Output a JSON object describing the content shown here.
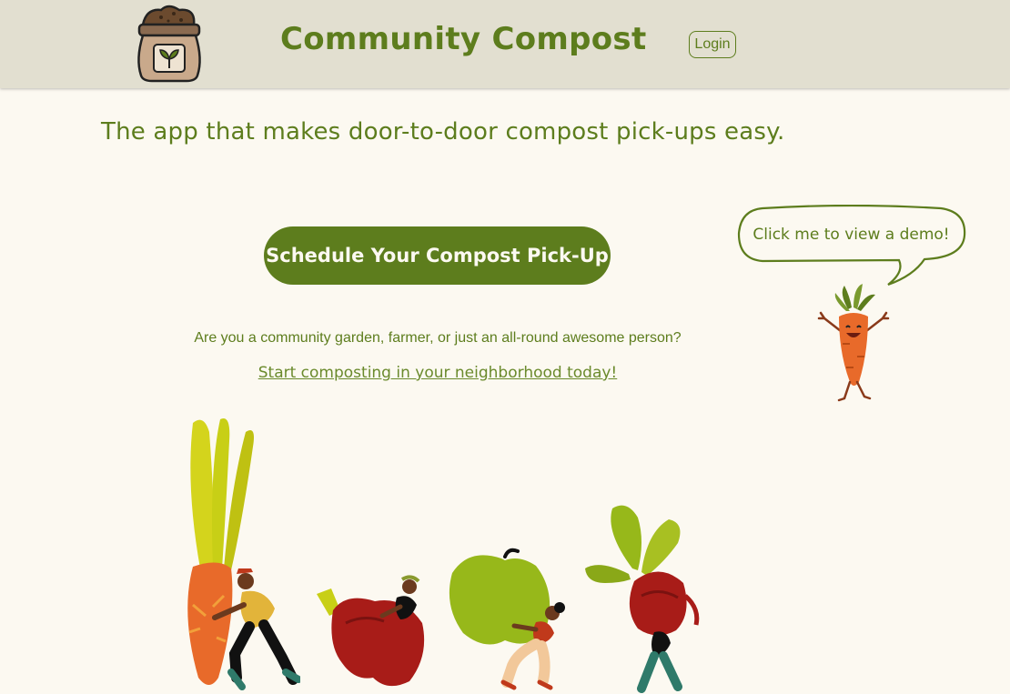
{
  "header": {
    "logo_icon": "compost-bag-icon",
    "title": "Community Compost",
    "login_label": "Login"
  },
  "main": {
    "tagline": "The app that makes door-to-door compost pick-ups easy.",
    "schedule_label": "Schedule Your Compost Pick-Up",
    "question": "Are you a community garden, farmer, or just an all-round awesome person?",
    "cta_link": "Start composting in your neighborhood today!"
  },
  "demo": {
    "bubble_text": "Click me to view a demo!",
    "mascot_icon": "carrot-mascot-icon"
  },
  "illustration": {
    "items": [
      "carrot-figure",
      "pepper-figure",
      "apple-figure",
      "beet-figure"
    ]
  },
  "colors": {
    "brand_green": "#5d7d1d",
    "header_bg": "#e2dfd0",
    "page_bg": "#fcf9f1",
    "carrot_orange": "#e86a2a"
  }
}
